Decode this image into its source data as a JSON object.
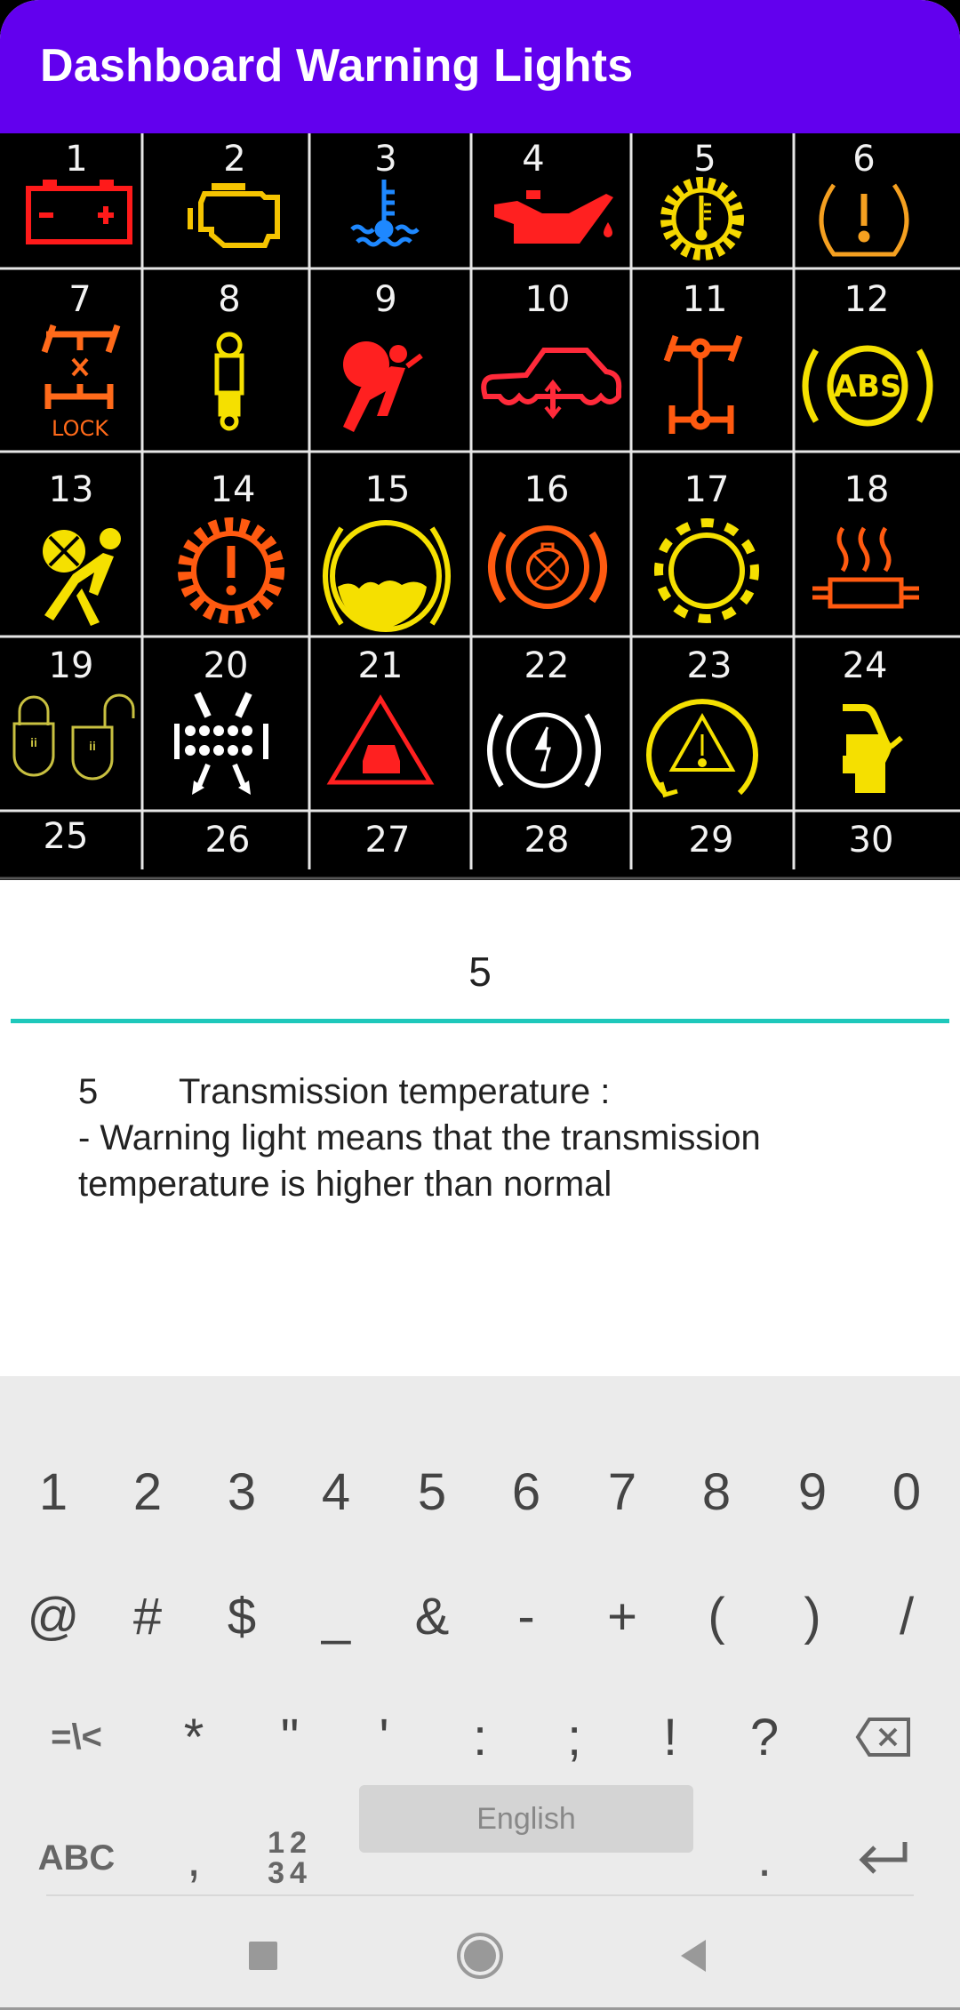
{
  "app": {
    "title": "Dashboard Warning Lights",
    "accent_color": "#6200EE",
    "input_underline_color": "#1EC8BB"
  },
  "lights_chart": {
    "cells": [
      {
        "number": "1",
        "icon": "battery-icon",
        "color": "#FF1A1A"
      },
      {
        "number": "2",
        "icon": "check-engine-icon",
        "color": "#F5C400"
      },
      {
        "number": "3",
        "icon": "coolant-temperature-icon",
        "color": "#1E88FF"
      },
      {
        "number": "4",
        "icon": "oil-pressure-icon",
        "color": "#FF2020"
      },
      {
        "number": "5",
        "icon": "transmission-temperature-icon",
        "color": "#F5D800"
      },
      {
        "number": "6",
        "icon": "tire-pressure-icon",
        "color": "#F5A020"
      },
      {
        "number": "7",
        "icon": "differential-lock-icon",
        "color": "#FF6A1A"
      },
      {
        "number": "8",
        "icon": "shock-absorber-icon",
        "color": "#F5E000"
      },
      {
        "number": "9",
        "icon": "airbag-icon",
        "color": "#FF2020"
      },
      {
        "number": "10",
        "icon": "suspension-height-icon",
        "color": "#FF2A3A"
      },
      {
        "number": "11",
        "icon": "four-wheel-drive-icon",
        "color": "#FF5A10"
      },
      {
        "number": "12",
        "icon": "abs-icon",
        "color": "#F5E000"
      },
      {
        "number": "13",
        "icon": "airbag-off-icon",
        "color": "#F5E000"
      },
      {
        "number": "14",
        "icon": "transmission-fault-icon",
        "color": "#FF5A10"
      },
      {
        "number": "15",
        "icon": "brake-pad-wear-icon",
        "color": "#F5E000"
      },
      {
        "number": "16",
        "icon": "parking-brake-fault-icon",
        "color": "#FF5A10"
      },
      {
        "number": "17",
        "icon": "brake-lining-icon",
        "color": "#F5E000"
      },
      {
        "number": "18",
        "icon": "catalytic-converter-icon",
        "color": "#FF5A10"
      },
      {
        "number": "19",
        "icon": "child-lock-icon",
        "color": "#C8C040"
      },
      {
        "number": "20",
        "icon": "glow-plug-filter-icon",
        "color": "#FFFFFF"
      },
      {
        "number": "21",
        "icon": "forward-collision-icon",
        "color": "#FF2020"
      },
      {
        "number": "22",
        "icon": "electric-parking-brake-icon",
        "color": "#FFFFFF"
      },
      {
        "number": "23",
        "icon": "stability-control-icon",
        "color": "#F5E000"
      },
      {
        "number": "24",
        "icon": "trunk-open-icon",
        "color": "#F5E000"
      },
      {
        "number": "25",
        "icon": "",
        "color": ""
      },
      {
        "number": "26",
        "icon": "",
        "color": ""
      },
      {
        "number": "27",
        "icon": "",
        "color": ""
      },
      {
        "number": "28",
        "icon": "",
        "color": ""
      },
      {
        "number": "29",
        "icon": "",
        "color": ""
      },
      {
        "number": "30",
        "icon": "",
        "color": ""
      }
    ]
  },
  "search": {
    "value": "5",
    "placeholder": ""
  },
  "result": {
    "number": "5",
    "title": "Transmission temperature :",
    "line1": "- Warning light means that the transmission",
    "line2": "temperature is higher than normal"
  },
  "keyboard": {
    "row1": [
      "1",
      "2",
      "3",
      "4",
      "5",
      "6",
      "7",
      "8",
      "9",
      "0"
    ],
    "row2": [
      "@",
      "#",
      "$",
      "_",
      "&",
      "-",
      "+",
      "(",
      ")",
      "/"
    ],
    "row3": [
      "=\\<",
      "*",
      "\"",
      "'",
      ":",
      ";",
      "!",
      "?"
    ],
    "row3_backspace": "backspace-icon",
    "row4": {
      "abc": "ABC",
      "comma": ",",
      "numpad_top": "12",
      "numpad_bottom": "34",
      "space": "English",
      "period": ".",
      "enter": "enter-icon"
    }
  },
  "navbar": {
    "recents": "recents-icon",
    "home": "home-icon",
    "back": "back-icon"
  }
}
